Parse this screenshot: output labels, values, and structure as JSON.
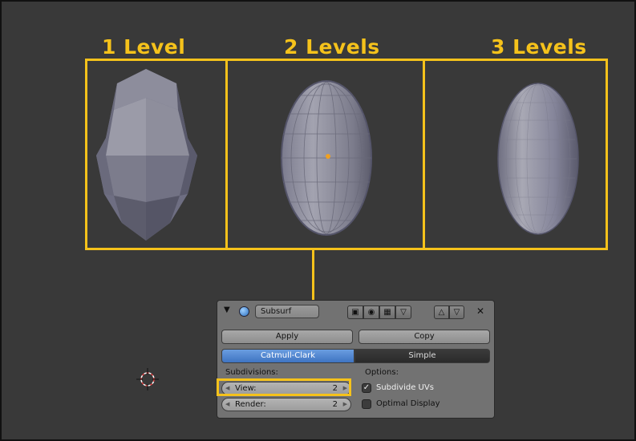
{
  "levels": [
    {
      "label": "1 Level"
    },
    {
      "label": "2 Levels"
    },
    {
      "label": "3 Levels"
    }
  ],
  "highlight_color": "#f5c21b",
  "viewport_bg": "#393939",
  "modifier": {
    "name": "Subsurf",
    "apply_label": "Apply",
    "copy_label": "Copy",
    "algorithms": [
      {
        "label": "Catmull-Clark",
        "active": true
      },
      {
        "label": "Simple",
        "active": false
      }
    ],
    "subdivisions_label": "Subdivisions:",
    "options_label": "Options:",
    "view": {
      "label": "View:",
      "value": "2"
    },
    "render": {
      "label": "Render:",
      "value": "2"
    },
    "options": [
      {
        "label": "Subdivide UVs",
        "checked": true
      },
      {
        "label": "Optimal Display",
        "checked": false
      }
    ],
    "active_color": "#4a7fc9"
  },
  "icons": [
    "collapse-triangle-icon",
    "modifier-type-icon",
    "render-toggle-icon",
    "viewport-toggle-icon",
    "editmode-toggle-icon",
    "cage-toggle-icon",
    "move-up-icon",
    "move-down-icon",
    "close-icon",
    "3d-cursor-icon",
    "origin-dot-icon"
  ]
}
